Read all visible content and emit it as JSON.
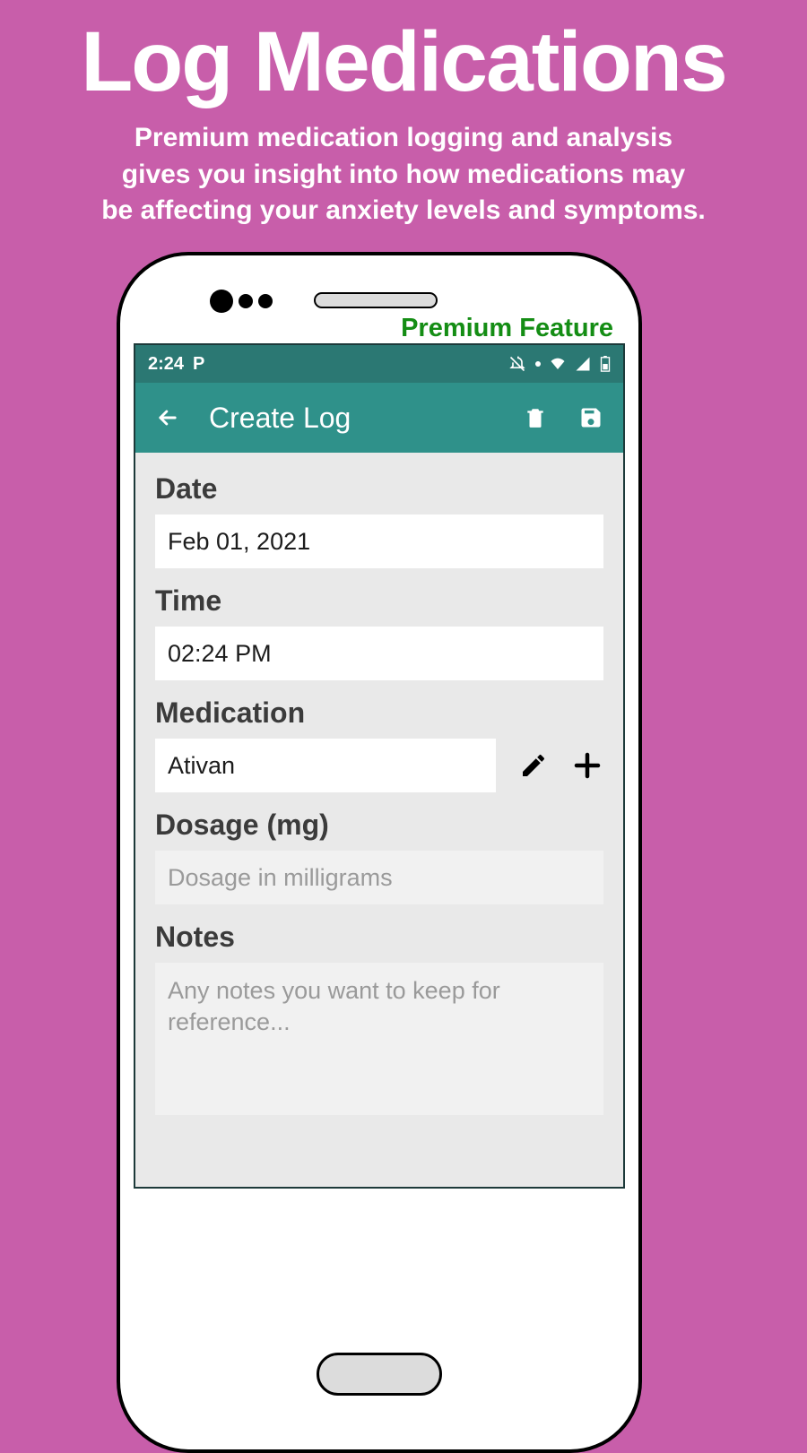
{
  "hero": {
    "title": "Log Medications",
    "sub1": "Premium medication logging and analysis",
    "sub2": "gives you insight into how medications may",
    "sub3": "be affecting your anxiety levels and symptoms."
  },
  "premium_tag": "Premium Feature",
  "statusbar": {
    "time": "2:24",
    "app_letter": "P"
  },
  "appbar": {
    "title": "Create Log"
  },
  "form": {
    "date_label": "Date",
    "date_value": "Feb 01, 2021",
    "time_label": "Time",
    "time_value": "02:24 PM",
    "medication_label": "Medication",
    "medication_value": "Ativan",
    "dosage_label": "Dosage (mg)",
    "dosage_placeholder": "Dosage in milligrams",
    "notes_label": "Notes",
    "notes_placeholder": "Any notes you want to keep for reference..."
  }
}
